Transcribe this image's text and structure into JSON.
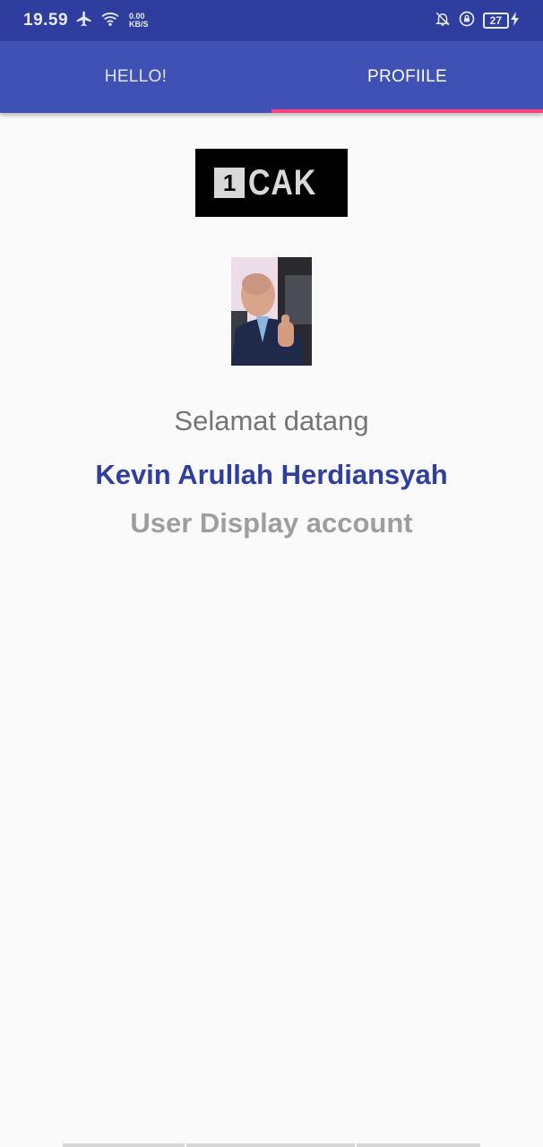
{
  "status_bar": {
    "time": "19.59",
    "netspeed_value": "0.00",
    "netspeed_unit": "KB/S",
    "battery": "27",
    "icons": [
      "airplane-icon",
      "wifi-icon",
      "notifications-off-icon",
      "lock-icon",
      "charging-icon"
    ]
  },
  "tabs": [
    {
      "label": "HELLO!",
      "active": false
    },
    {
      "label": "PROFIILE",
      "active": true
    }
  ],
  "logo": {
    "digit": "1",
    "text": "CAK"
  },
  "profile": {
    "greeting": "Selamat datang",
    "name": "Kevin Arullah Herdiansyah",
    "account_label": "User Display account"
  },
  "colors": {
    "status_bar": "#2f3e9e",
    "tab_bar": "#3f51b5",
    "tab_indicator": "#ff4081",
    "name_text": "#303f9f"
  }
}
